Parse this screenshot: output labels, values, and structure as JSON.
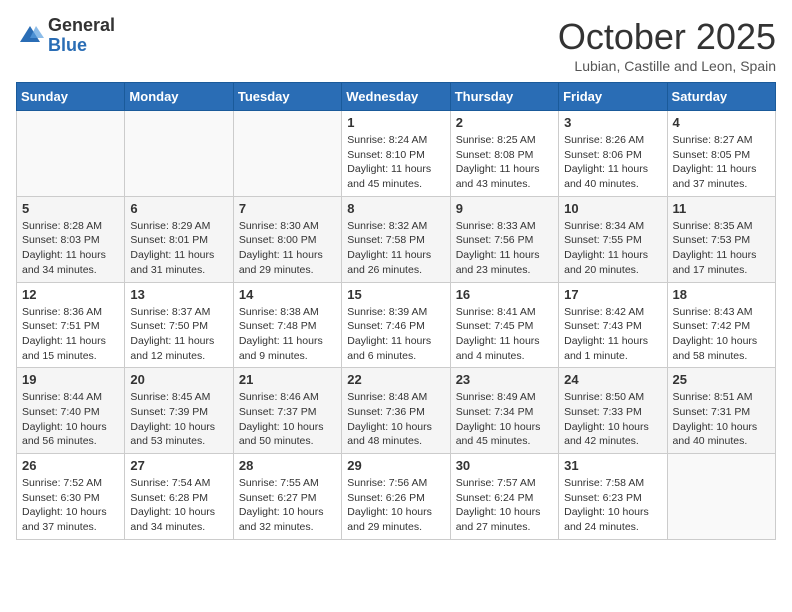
{
  "header": {
    "logo_general": "General",
    "logo_blue": "Blue",
    "month_title": "October 2025",
    "subtitle": "Lubian, Castille and Leon, Spain"
  },
  "days_of_week": [
    "Sunday",
    "Monday",
    "Tuesday",
    "Wednesday",
    "Thursday",
    "Friday",
    "Saturday"
  ],
  "weeks": [
    [
      {
        "num": "",
        "info": ""
      },
      {
        "num": "",
        "info": ""
      },
      {
        "num": "",
        "info": ""
      },
      {
        "num": "1",
        "info": "Sunrise: 8:24 AM\nSunset: 8:10 PM\nDaylight: 11 hours and 45 minutes."
      },
      {
        "num": "2",
        "info": "Sunrise: 8:25 AM\nSunset: 8:08 PM\nDaylight: 11 hours and 43 minutes."
      },
      {
        "num": "3",
        "info": "Sunrise: 8:26 AM\nSunset: 8:06 PM\nDaylight: 11 hours and 40 minutes."
      },
      {
        "num": "4",
        "info": "Sunrise: 8:27 AM\nSunset: 8:05 PM\nDaylight: 11 hours and 37 minutes."
      }
    ],
    [
      {
        "num": "5",
        "info": "Sunrise: 8:28 AM\nSunset: 8:03 PM\nDaylight: 11 hours and 34 minutes."
      },
      {
        "num": "6",
        "info": "Sunrise: 8:29 AM\nSunset: 8:01 PM\nDaylight: 11 hours and 31 minutes."
      },
      {
        "num": "7",
        "info": "Sunrise: 8:30 AM\nSunset: 8:00 PM\nDaylight: 11 hours and 29 minutes."
      },
      {
        "num": "8",
        "info": "Sunrise: 8:32 AM\nSunset: 7:58 PM\nDaylight: 11 hours and 26 minutes."
      },
      {
        "num": "9",
        "info": "Sunrise: 8:33 AM\nSunset: 7:56 PM\nDaylight: 11 hours and 23 minutes."
      },
      {
        "num": "10",
        "info": "Sunrise: 8:34 AM\nSunset: 7:55 PM\nDaylight: 11 hours and 20 minutes."
      },
      {
        "num": "11",
        "info": "Sunrise: 8:35 AM\nSunset: 7:53 PM\nDaylight: 11 hours and 17 minutes."
      }
    ],
    [
      {
        "num": "12",
        "info": "Sunrise: 8:36 AM\nSunset: 7:51 PM\nDaylight: 11 hours and 15 minutes."
      },
      {
        "num": "13",
        "info": "Sunrise: 8:37 AM\nSunset: 7:50 PM\nDaylight: 11 hours and 12 minutes."
      },
      {
        "num": "14",
        "info": "Sunrise: 8:38 AM\nSunset: 7:48 PM\nDaylight: 11 hours and 9 minutes."
      },
      {
        "num": "15",
        "info": "Sunrise: 8:39 AM\nSunset: 7:46 PM\nDaylight: 11 hours and 6 minutes."
      },
      {
        "num": "16",
        "info": "Sunrise: 8:41 AM\nSunset: 7:45 PM\nDaylight: 11 hours and 4 minutes."
      },
      {
        "num": "17",
        "info": "Sunrise: 8:42 AM\nSunset: 7:43 PM\nDaylight: 11 hours and 1 minute."
      },
      {
        "num": "18",
        "info": "Sunrise: 8:43 AM\nSunset: 7:42 PM\nDaylight: 10 hours and 58 minutes."
      }
    ],
    [
      {
        "num": "19",
        "info": "Sunrise: 8:44 AM\nSunset: 7:40 PM\nDaylight: 10 hours and 56 minutes."
      },
      {
        "num": "20",
        "info": "Sunrise: 8:45 AM\nSunset: 7:39 PM\nDaylight: 10 hours and 53 minutes."
      },
      {
        "num": "21",
        "info": "Sunrise: 8:46 AM\nSunset: 7:37 PM\nDaylight: 10 hours and 50 minutes."
      },
      {
        "num": "22",
        "info": "Sunrise: 8:48 AM\nSunset: 7:36 PM\nDaylight: 10 hours and 48 minutes."
      },
      {
        "num": "23",
        "info": "Sunrise: 8:49 AM\nSunset: 7:34 PM\nDaylight: 10 hours and 45 minutes."
      },
      {
        "num": "24",
        "info": "Sunrise: 8:50 AM\nSunset: 7:33 PM\nDaylight: 10 hours and 42 minutes."
      },
      {
        "num": "25",
        "info": "Sunrise: 8:51 AM\nSunset: 7:31 PM\nDaylight: 10 hours and 40 minutes."
      }
    ],
    [
      {
        "num": "26",
        "info": "Sunrise: 7:52 AM\nSunset: 6:30 PM\nDaylight: 10 hours and 37 minutes."
      },
      {
        "num": "27",
        "info": "Sunrise: 7:54 AM\nSunset: 6:28 PM\nDaylight: 10 hours and 34 minutes."
      },
      {
        "num": "28",
        "info": "Sunrise: 7:55 AM\nSunset: 6:27 PM\nDaylight: 10 hours and 32 minutes."
      },
      {
        "num": "29",
        "info": "Sunrise: 7:56 AM\nSunset: 6:26 PM\nDaylight: 10 hours and 29 minutes."
      },
      {
        "num": "30",
        "info": "Sunrise: 7:57 AM\nSunset: 6:24 PM\nDaylight: 10 hours and 27 minutes."
      },
      {
        "num": "31",
        "info": "Sunrise: 7:58 AM\nSunset: 6:23 PM\nDaylight: 10 hours and 24 minutes."
      },
      {
        "num": "",
        "info": ""
      }
    ]
  ]
}
